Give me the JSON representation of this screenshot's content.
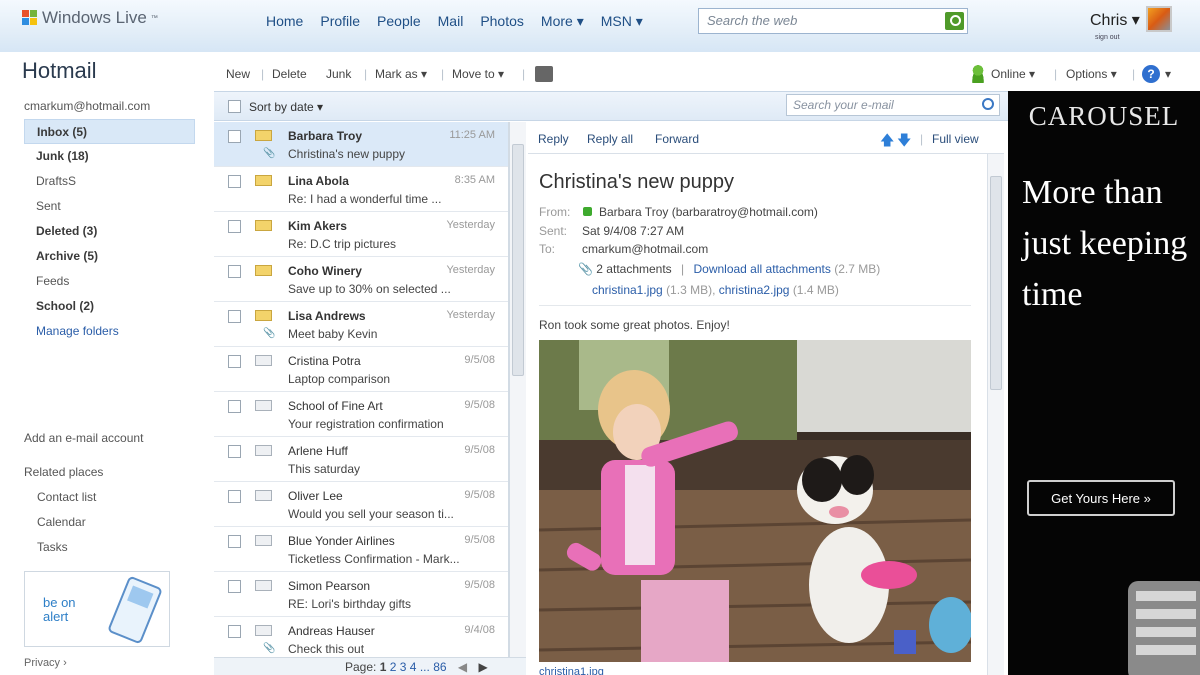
{
  "brand": {
    "logo_text": "Windows Live",
    "trademark": "™"
  },
  "topnav": [
    "Home",
    "Profile",
    "People",
    "Mail",
    "Photos",
    "More ▾",
    "MSN ▾"
  ],
  "web_search": {
    "placeholder": "Search the web"
  },
  "user": {
    "name": "Chris ▾",
    "signout": "sign out"
  },
  "app_title": "Hotmail",
  "account": "cmarkum@hotmail.com",
  "folders": [
    {
      "label": "Inbox (5)",
      "bold": true,
      "selected": true
    },
    {
      "label": "Junk (18)",
      "bold": true
    },
    {
      "label": "DraftsS"
    },
    {
      "label": "Sent"
    },
    {
      "label": "Deleted (3)",
      "bold": true
    },
    {
      "label": "Archive (5)",
      "bold": true
    },
    {
      "label": "Feeds"
    },
    {
      "label": "School (2)",
      "bold": true
    },
    {
      "label": "Manage folders",
      "link": true
    }
  ],
  "left_links": {
    "add_account": "Add an e-mail account",
    "related_title": "Related places",
    "related": [
      "Contact list",
      "Calendar",
      "Tasks"
    ],
    "alert_text_1": "be on",
    "alert_text_2": "alert",
    "privacy": "Privacy ›"
  },
  "toolbar": {
    "new": "New",
    "delete": "Delete",
    "junk": "Junk",
    "mark_as": "Mark as ▾",
    "move_to": "Move to ▾",
    "online": "Online ▾",
    "options": "Options ▾",
    "help": "▾"
  },
  "list": {
    "sort": "Sort by date ▾",
    "search_placeholder": "Search your e-mail",
    "messages": [
      {
        "sender": "Barbara Troy",
        "subject": "Christina's new puppy",
        "date": "11:25 AM",
        "unread": true,
        "attach": true
      },
      {
        "sender": "Lina Abola",
        "subject": "Re: I had a wonderful time ...",
        "date": "8:35 AM",
        "unread": true
      },
      {
        "sender": "Kim Akers",
        "subject": "Re: D.C trip pictures",
        "date": "Yesterday",
        "unread": true
      },
      {
        "sender": "Coho Winery",
        "subject": "Save up to 30% on selected ...",
        "date": "Yesterday",
        "unread": true
      },
      {
        "sender": "Lisa Andrews",
        "subject": "Meet baby Kevin",
        "date": "Yesterday",
        "unread": true,
        "attach": true
      },
      {
        "sender": "Cristina Potra",
        "subject": "Laptop comparison",
        "date": "9/5/08"
      },
      {
        "sender": "School of Fine Art",
        "subject": "Your registration confirmation",
        "date": "9/5/08"
      },
      {
        "sender": "Arlene Huff",
        "subject": "This saturday",
        "date": "9/5/08"
      },
      {
        "sender": "Oliver Lee",
        "subject": "Would you sell your season ti...",
        "date": "9/5/08"
      },
      {
        "sender": "Blue Yonder Airlines",
        "subject": "Ticketless Confirmation - Mark...",
        "date": "9/5/08"
      },
      {
        "sender": "Simon Pearson",
        "subject": "RE: Lori's birthday gifts",
        "date": "9/5/08"
      },
      {
        "sender": "Andreas Hauser",
        "subject": "Check this out",
        "date": "9/4/08",
        "attach": true
      }
    ],
    "pager": {
      "label": "Page:",
      "current": "1",
      "pages": [
        "2",
        "3",
        "4",
        "...",
        "86"
      ]
    }
  },
  "reading": {
    "actions": [
      "Reply",
      "Reply all",
      "Forward"
    ],
    "full_view": "Full view",
    "subject": "Christina's new puppy",
    "from_label": "From:",
    "from": "Barbara Troy (barbaratroy@hotmail.com)",
    "sent_label": "Sent:",
    "sent": "Sat 9/4/08 7:27 AM",
    "to_label": "To:",
    "to": "cmarkum@hotmail.com",
    "attachments": "2 attachments",
    "download_all": "Download all attachments",
    "total_size": "(2.7 MB)",
    "file1": "christina1.jpg",
    "file1_size": "(1.3 MB),",
    "file2": "christina2.jpg",
    "file2_size": "(1.4 MB)",
    "body": "Ron took some great photos. Enjoy!",
    "photo_caption": "christina1.jpg"
  },
  "ad": {
    "title": "CAROUSEL",
    "headline": "More than just keeping time",
    "cta": "Get Yours Here »"
  },
  "colors": {
    "link": "#2a5da8",
    "nav": "#1f4f86",
    "selected_row": "#dbe9f8",
    "ad_bg": "#050505"
  }
}
